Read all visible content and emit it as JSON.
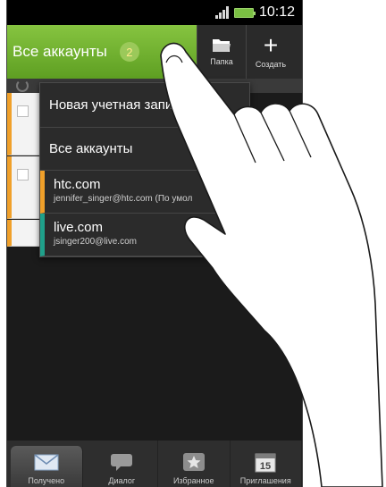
{
  "status_bar": {
    "time": "10:12"
  },
  "action_bar": {
    "account_title": "Все аккаунты",
    "unread_count": "2",
    "folder_label": "Папка",
    "create_label": "Создать"
  },
  "menu": {
    "items": [
      {
        "label": "Новая учетная запис"
      },
      {
        "label": "Все аккаунты"
      }
    ],
    "accounts": [
      {
        "name": "htc.com",
        "address": "jennifer_singer@htc.com (По умол"
      },
      {
        "name": "live.com",
        "address": "jsinger200@live.com"
      }
    ]
  },
  "tabs": [
    {
      "label": "Получено",
      "icon": "envelope-icon",
      "active": true
    },
    {
      "label": "Диалог",
      "icon": "chat-icon",
      "active": false
    },
    {
      "label": "Избранное",
      "icon": "star-icon",
      "active": false
    },
    {
      "label": "Приглашения",
      "icon": "calendar-icon",
      "active": false
    }
  ],
  "calendar_day": "15",
  "colors": {
    "accent_green": "#86c440",
    "htc_account": "#f0a02a",
    "live_account": "#1fa08a"
  }
}
